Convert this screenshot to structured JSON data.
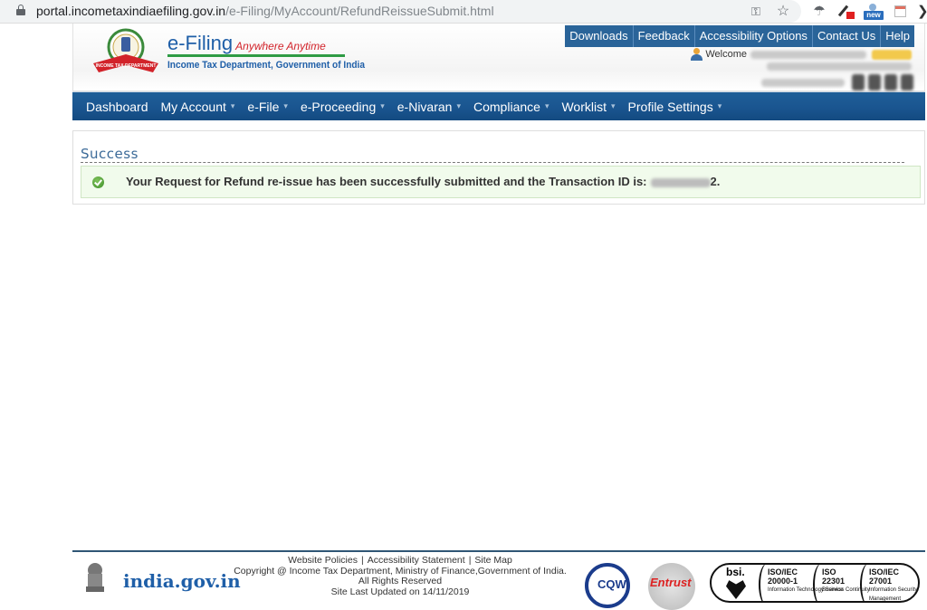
{
  "browser": {
    "url_host": "portal.incometaxindiaefiling.gov.in",
    "url_path": "/e-Filing/MyAccount/RefundReissueSubmit.html",
    "icons": [
      "lock-icon",
      "key-icon",
      "star-icon",
      "extension-icon",
      "extension-icon",
      "extension-new-icon",
      "extension-icon",
      "more-icon"
    ],
    "new_badge": "new"
  },
  "header": {
    "brand_title": "e-Filing",
    "brand_tagline": "Anywhere Anytime",
    "brand_subtitle": "Income Tax Department, Government of India",
    "top_links": [
      "Downloads",
      "Feedback",
      "Accessibility Options",
      "Contact Us",
      "Help"
    ],
    "welcome_label": "Welcome"
  },
  "nav": {
    "items": [
      {
        "label": "Dashboard",
        "dropdown": false
      },
      {
        "label": "My Account",
        "dropdown": true
      },
      {
        "label": "e-File",
        "dropdown": true
      },
      {
        "label": "e-Proceeding",
        "dropdown": true
      },
      {
        "label": "e-Nivaran",
        "dropdown": true
      },
      {
        "label": "Compliance",
        "dropdown": true
      },
      {
        "label": "Worklist",
        "dropdown": true
      },
      {
        "label": "Profile Settings",
        "dropdown": true
      }
    ],
    "caret": "⌄"
  },
  "content": {
    "title": "Success",
    "message": "Your Request for Refund re-issue has been successfully submitted and the Transaction ID is:",
    "transaction_id_suffix": "2."
  },
  "footer": {
    "india_gov": "india.gov.in",
    "links": [
      "Website Policies",
      "Accessibility Statement",
      "Site Map"
    ],
    "separator": "|",
    "copyright": "Copyright @ Income Tax Department, Ministry of Finance,Government of India.",
    "rights": "All Rights Reserved",
    "last_updated": "Site Last Updated on 14/11/2019",
    "certs": {
      "cqw": "CQW",
      "entrust": "Entrust",
      "bsi": "bsi.",
      "iso": [
        {
          "code": "ISO/IEC",
          "number": "20000-1",
          "desc": "Information Technology Service"
        },
        {
          "code": "ISO",
          "number": "22301",
          "desc": "Business Continuity"
        },
        {
          "code": "ISO/IEC",
          "number": "27001",
          "desc": "Information Security Management"
        }
      ]
    }
  },
  "colors": {
    "nav_blue": "#1a5590",
    "top_link_blue": "#2a6499",
    "brand_blue": "#1f5fa8",
    "tagline_red": "#d2232a",
    "success_bg": "#f1fbec",
    "success_green": "#3e8f2a"
  }
}
